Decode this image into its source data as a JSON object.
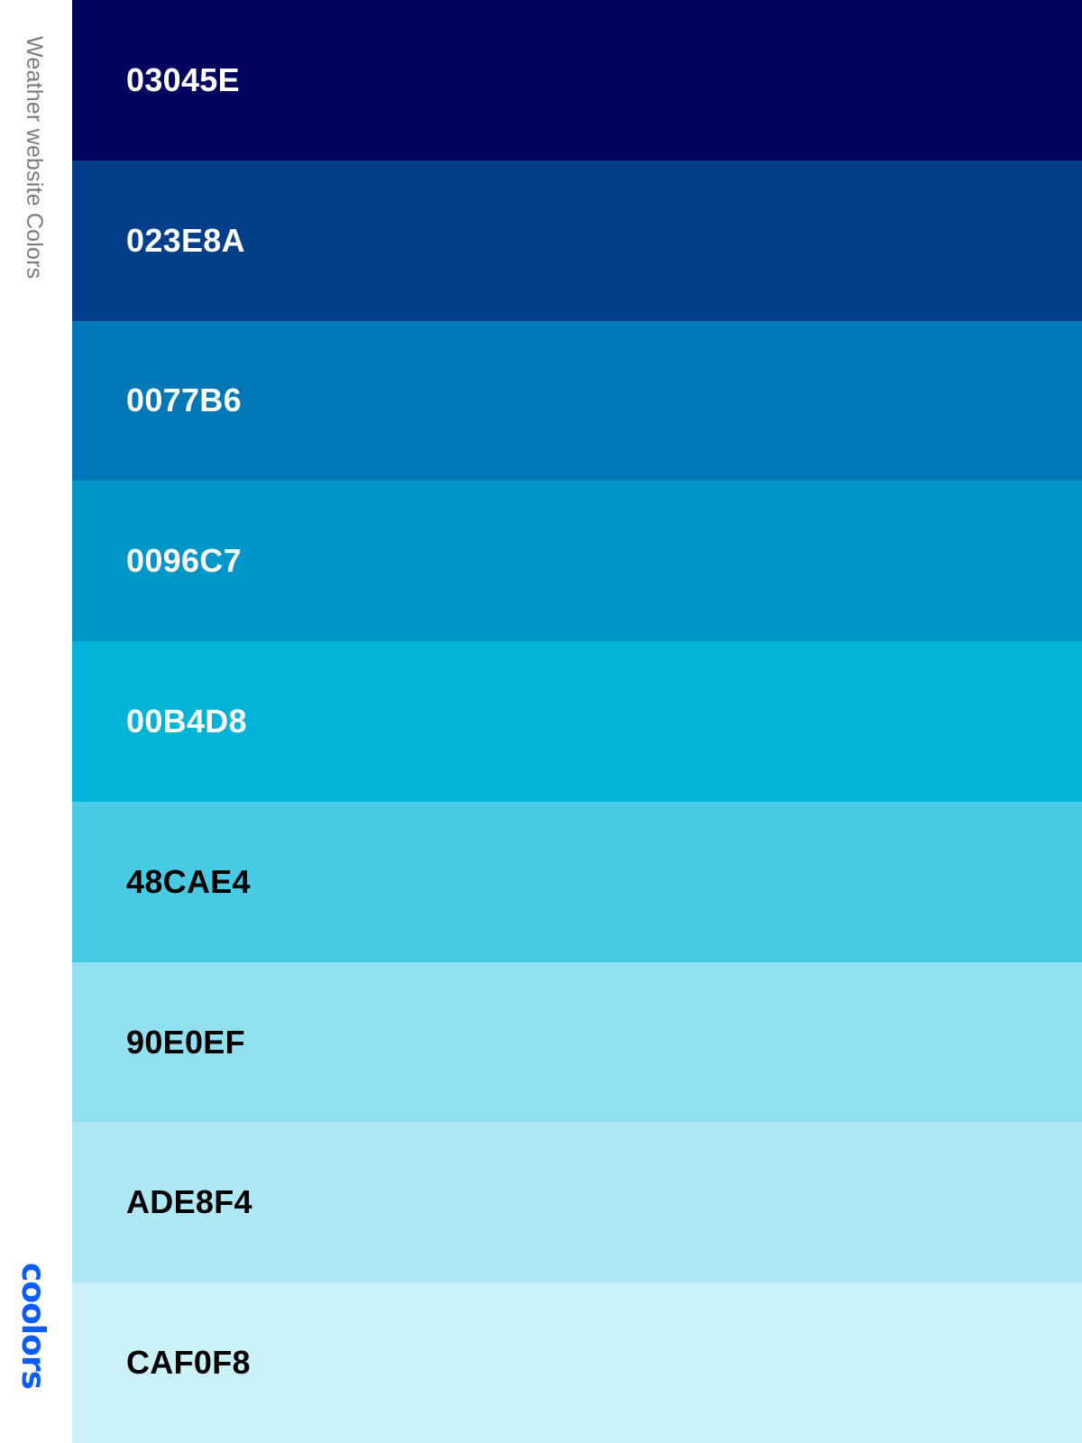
{
  "palette": {
    "title": "Weather website Colors",
    "brand": "coolors",
    "brand_color": "#0b5cff",
    "title_color": "#7b7b7b",
    "swatches": [
      {
        "code": "03045E",
        "color": "#03045E",
        "text_color": "#ffffff"
      },
      {
        "code": "023E8A",
        "color": "#023E8A",
        "text_color": "#ffffff"
      },
      {
        "code": "0077B6",
        "color": "#0077B6",
        "text_color": "#ffffff"
      },
      {
        "code": "0096C7",
        "color": "#0096C7",
        "text_color": "#ffffff"
      },
      {
        "code": "00B4D8",
        "color": "#00B4D8",
        "text_color": "#ffffff"
      },
      {
        "code": "48CAE4",
        "color": "#48CAE4",
        "text_color": "#000000"
      },
      {
        "code": "90E0EF",
        "color": "#90E0EF",
        "text_color": "#000000"
      },
      {
        "code": "ADE8F4",
        "color": "#ADE8F4",
        "text_color": "#000000"
      },
      {
        "code": "CAF0F8",
        "color": "#CAF0F8",
        "text_color": "#000000"
      }
    ]
  }
}
